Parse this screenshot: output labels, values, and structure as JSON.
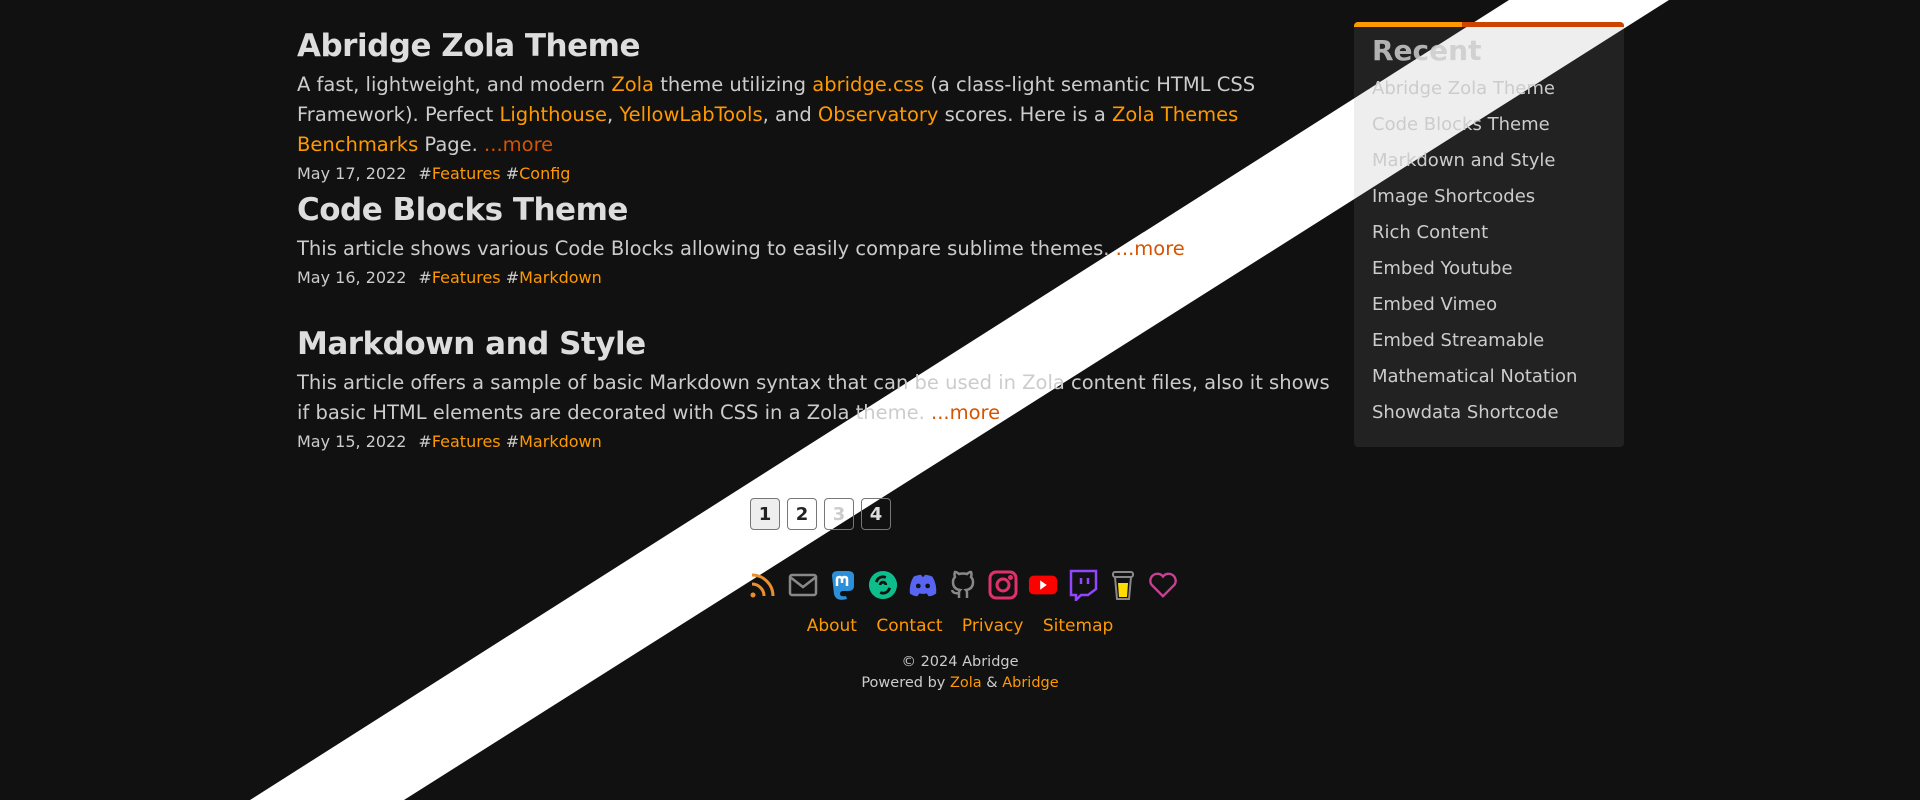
{
  "posts": [
    {
      "title": "Abridge Zola Theme",
      "text": [
        {
          "t": "A fast, lightweight, and modern "
        },
        {
          "t": "Zola",
          "link": true
        },
        {
          "t": " theme utilizing "
        },
        {
          "t": "abridge.css",
          "link": true
        },
        {
          "t": " (a class-light semantic HTML CSS Framework). Perfect "
        },
        {
          "t": "Lighthouse",
          "link": true
        },
        {
          "t": ", "
        },
        {
          "t": "YellowLabTools",
          "link": true
        },
        {
          "t": ", and "
        },
        {
          "t": "Observatory",
          "link": true
        },
        {
          "t": " scores. Here is a "
        },
        {
          "t": "Zola Themes Benchmarks",
          "link": true
        },
        {
          "t": " Page. "
        }
      ],
      "more": "...more",
      "date": "May 17, 2022",
      "tags": [
        "Features",
        "Config"
      ]
    },
    {
      "title": "Code Blocks Theme",
      "text": [
        {
          "t": "This article shows various Code Blocks allowing to easily compare sublime themes. "
        }
      ],
      "more": "...more",
      "date": "May 16, 2022",
      "tags": [
        "Features",
        "Markdown"
      ]
    },
    {
      "title": "Markdown and Style",
      "text": [
        {
          "t": "This article offers a sample of basic Markdown syntax that can be used in Zola content files, also it shows if basic HTML elements are decorated with CSS in a Zola theme. "
        }
      ],
      "more": "...more",
      "date": "May 15, 2022",
      "tags": [
        "Features",
        "Markdown"
      ]
    }
  ],
  "sidebar": {
    "title": "Recent",
    "items": [
      "Abridge Zola Theme",
      "Code Blocks Theme",
      "Markdown and Style",
      "Image Shortcodes",
      "Rich Content",
      "Embed Youtube",
      "Embed Vimeo",
      "Embed Streamable",
      "Mathematical Notation",
      "Showdata Shortcode"
    ]
  },
  "pagination": {
    "pages": [
      "1",
      "2",
      "3",
      "4"
    ],
    "current": "1"
  },
  "social_icons": [
    "rss-icon",
    "mail-icon",
    "mastodon-icon",
    "matrix-icon",
    "discord-icon",
    "github-icon",
    "instagram-icon",
    "youtube-icon",
    "twitch-icon",
    "buymeacoffee-icon",
    "heart-icon"
  ],
  "footer": {
    "links": [
      "About",
      "Contact",
      "Privacy",
      "Sitemap"
    ],
    "copyright": "© 2024 Abridge",
    "powered_prefix": "Powered by ",
    "powered_zola": "Zola",
    "powered_amp": " & ",
    "powered_abridge": "Abridge"
  },
  "colors": {
    "accent": "#ff9900",
    "more": "#d45500",
    "background": "#111111",
    "sidebar": "#222222"
  }
}
